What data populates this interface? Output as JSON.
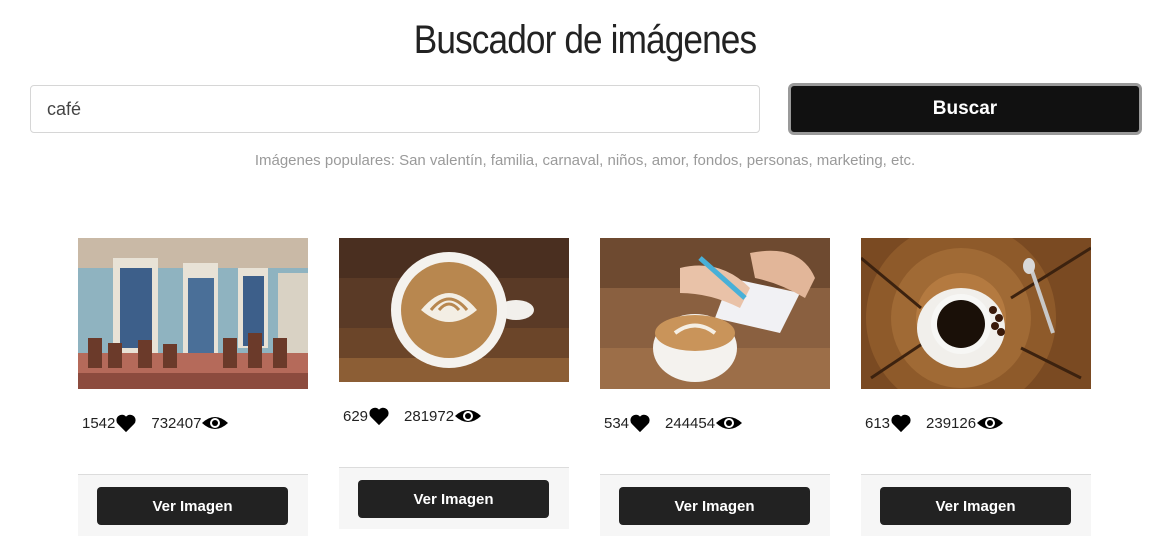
{
  "header": {
    "title": "Buscador de imágenes"
  },
  "search": {
    "value": "café",
    "button_label": "Buscar"
  },
  "popular_text": "Imágenes populares: San valentín, familia, carnaval, niños, amor, fondos, personas, marketing, etc.",
  "results": [
    {
      "photo_icon": "cafe-storefront-photo",
      "likes": "1542",
      "views": "732407",
      "button_label": "Ver Imagen"
    },
    {
      "photo_icon": "latte-art-cup-photo",
      "likes": "629",
      "views": "281972",
      "button_label": "Ver Imagen"
    },
    {
      "photo_icon": "writing-with-coffee-photo",
      "likes": "534",
      "views": "244454",
      "button_label": "Ver Imagen"
    },
    {
      "photo_icon": "black-coffee-cup-photo",
      "likes": "613",
      "views": "239126",
      "button_label": "Ver Imagen"
    }
  ],
  "icons": {
    "like": "heart-icon",
    "views": "eye-icon"
  },
  "colors": {
    "button_dark": "#111111",
    "card_button": "#222222",
    "muted_text": "#9a9a9a"
  }
}
